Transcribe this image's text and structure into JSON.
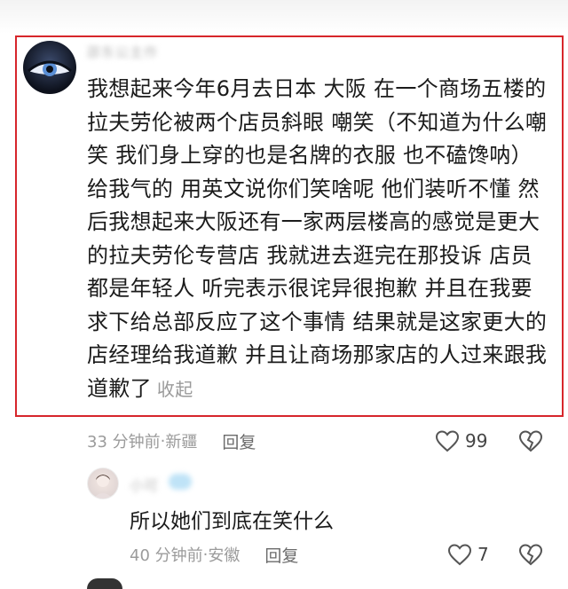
{
  "comment": {
    "username": "邵东公主作",
    "text": "我想起来今年6月去日本 大阪 在一个商场五楼的\n拉夫劳伦被两个店员斜眼 嘲笑（不知道为什么嘲\n笑 我们身上穿的也是名牌的衣服 也不磕馋呐）\n给我气的 用英文说你们笑啥呢 他们装听不懂 然\n后我想起来大阪还有一家两层楼高的感觉是更大\n的拉夫劳伦专营店 我就进去逛完在那投诉 店员\n都是年轻人 听完表示很诧异很抱歉 并且在我要\n求下给总部反应了这个事情 结果就是这家更大的\n店经理给我道歉 并且让商场那家店的人过来跟我\n道歉了",
    "collapse_label": "收起",
    "time": "33 分钟前",
    "location": "新疆",
    "reply_label": "回复",
    "likes": "99",
    "highlight_color": "#d7262b"
  },
  "reply": {
    "username": "小可",
    "text": "所以她们到底在笑什么",
    "time": "40 分钟前",
    "location": "安徽",
    "reply_label": "回复",
    "likes": "7"
  },
  "separator": " · ",
  "icons": [
    "heart-icon",
    "broken-heart-icon"
  ]
}
